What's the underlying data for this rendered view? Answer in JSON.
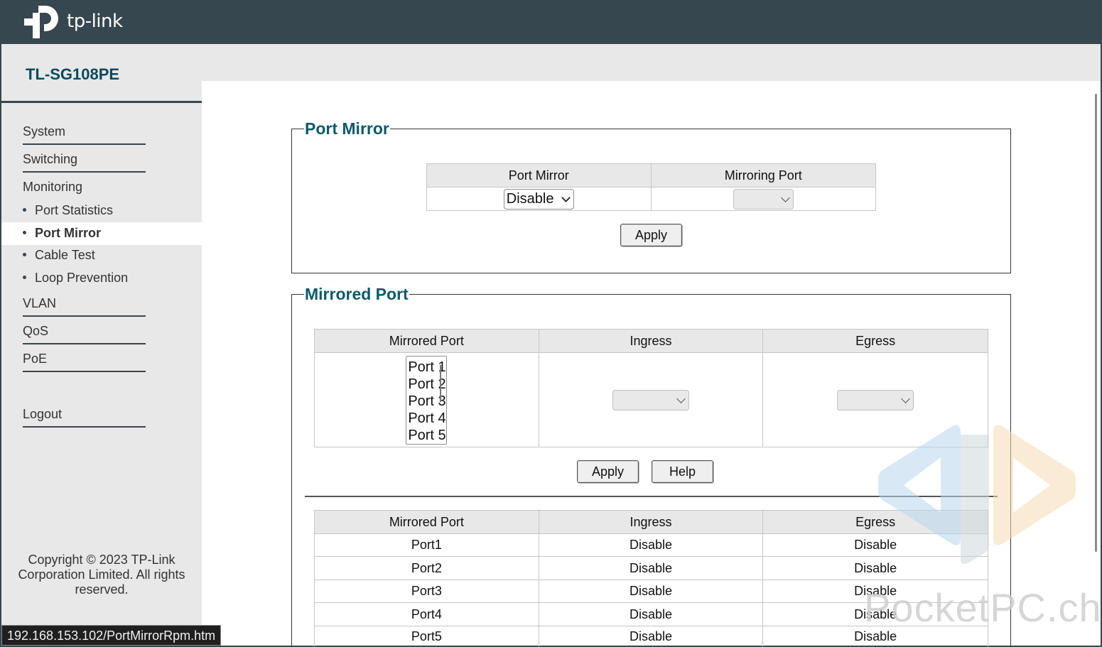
{
  "header": {
    "brand": "tp-link"
  },
  "sidebar": {
    "model": "TL-SG108PE",
    "items": [
      {
        "label": "System"
      },
      {
        "label": "Switching"
      },
      {
        "label": "Monitoring"
      },
      {
        "label": "VLAN"
      },
      {
        "label": "QoS"
      },
      {
        "label": "PoE"
      },
      {
        "label": "Logout"
      }
    ],
    "monitoring_sub": [
      {
        "label": "Port Statistics"
      },
      {
        "label": "Port Mirror",
        "active": true
      },
      {
        "label": "Cable Test"
      },
      {
        "label": "Loop Prevention"
      }
    ],
    "copyright": "Copyright © 2023 TP-Link Corporation Limited. All rights reserved."
  },
  "port_mirror": {
    "title": "Port Mirror",
    "col_port_mirror": "Port Mirror",
    "col_mirroring_port": "Mirroring Port",
    "port_mirror_value": "Disable",
    "mirroring_port_value": "",
    "apply_label": "Apply"
  },
  "mirrored_port": {
    "title": "Mirrored Port",
    "col_mirrored_port": "Mirrored Port",
    "col_ingress": "Ingress",
    "col_egress": "Egress",
    "list_options": [
      "Port 1",
      "Port 2",
      "Port 3",
      "Port 4",
      "Port 5"
    ],
    "ingress_value": "",
    "egress_value": "",
    "apply_label": "Apply",
    "help_label": "Help"
  },
  "summary_table": {
    "headers": [
      "Mirrored Port",
      "Ingress",
      "Egress"
    ],
    "rows": [
      [
        "Port1",
        "Disable",
        "Disable"
      ],
      [
        "Port2",
        "Disable",
        "Disable"
      ],
      [
        "Port3",
        "Disable",
        "Disable"
      ],
      [
        "Port4",
        "Disable",
        "Disable"
      ],
      [
        "Port5",
        "Disable",
        "Disable"
      ]
    ]
  },
  "status_bar": {
    "url": "192.168.153.102/PortMirrorRpm.htm"
  },
  "watermark": {
    "text": "PocketPC.ch"
  }
}
